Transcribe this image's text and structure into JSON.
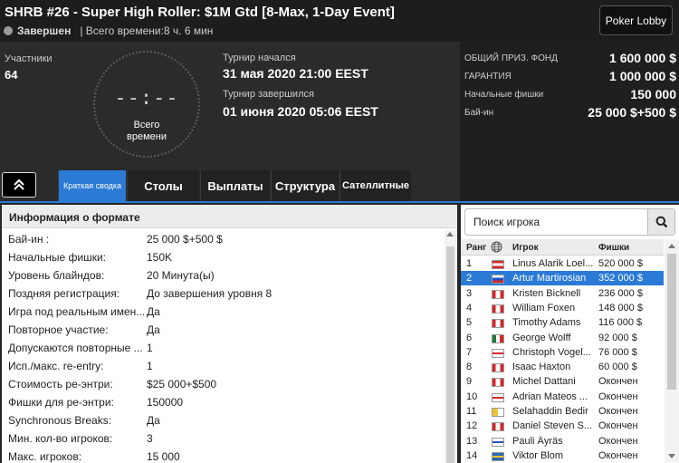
{
  "header": {
    "title": "SHRB #26 - Super High Roller: $1M Gtd [8-Max, 1-Day Event]",
    "status": "Завершен",
    "total_time": "| Всего времени:8 ч. 6 мин",
    "lobby_button": "Poker Lobby"
  },
  "info": {
    "participants_label": "Участники",
    "participants_value": "64",
    "clock_digits": "--:--",
    "clock_label_1": "Всего",
    "clock_label_2": "времени",
    "started_label": "Турнир начался",
    "started_value": "31 мая 2020  21:00 EEST",
    "ended_label": "Турнир завершился",
    "ended_value": "01 июня 2020  05:06 EEST"
  },
  "prize": [
    {
      "label": "ОБЩИЙ ПРИЗ. ФОНД",
      "value": "1 600 000 $"
    },
    {
      "label": "ГАРАНТИЯ",
      "value": "1 000 000 $"
    },
    {
      "label": "Начальные фишки",
      "value": "150 000"
    },
    {
      "label": "Бай-ин",
      "value": "25 000 $+500 $"
    }
  ],
  "tabs": [
    "Краткая сводка",
    "Столы",
    "Выплаты",
    "Структура",
    "Сателлитные"
  ],
  "format": {
    "title": "Информация о формате",
    "rows": [
      {
        "k": "Бай-ин :",
        "v": "25 000 $+500 $"
      },
      {
        "k": "Начальные фишки:",
        "v": "150K"
      },
      {
        "k": "Уровень блайндов:",
        "v": "20 Минута(ы)"
      },
      {
        "k": "Поздняя регистрация:",
        "v": "До завершения уровня 8"
      },
      {
        "k": "Игра под реальным имен...",
        "v": "Да"
      },
      {
        "k": "Повторное участие:",
        "v": "Да"
      },
      {
        "k": "Допускаются повторные ...",
        "v": "1"
      },
      {
        "k": "Исп./макс. re-entry:",
        "v": "1"
      },
      {
        "k": "Стоимость ре-энтри:",
        "v": "$25 000+$500"
      },
      {
        "k": "Фишки для ре-энтри:",
        "v": "150000"
      },
      {
        "k": "Synchronous Breaks:",
        "v": "Да"
      },
      {
        "k": "Мин. кол-во игроков:",
        "v": "3"
      },
      {
        "k": "Макс. игроков:",
        "v": "15 000"
      }
    ]
  },
  "players": {
    "search_placeholder": "Поиск игрока",
    "columns": {
      "rank": "Ранг",
      "name": "Игрок",
      "chips": "Фишки"
    },
    "rows": [
      {
        "rank": "1",
        "name": "Linus Alarik Loel...",
        "chips": "520 000 $",
        "flag": "at"
      },
      {
        "rank": "2",
        "name": "Artur Martirosian",
        "chips": "352 000 $",
        "flag": "ru"
      },
      {
        "rank": "3",
        "name": "Kristen Bicknell",
        "chips": "236 000 $",
        "flag": "ca"
      },
      {
        "rank": "4",
        "name": "William Foxen",
        "chips": "148 000 $",
        "flag": "ca"
      },
      {
        "rank": "5",
        "name": "Timothy Adams",
        "chips": "116 000 $",
        "flag": "ca"
      },
      {
        "rank": "6",
        "name": "George Wolff",
        "chips": "92 000 $",
        "flag": "mx"
      },
      {
        "rank": "7",
        "name": "Christoph Vogel...",
        "chips": "76 000 $",
        "flag": "gb"
      },
      {
        "rank": "8",
        "name": "Isaac Haxton",
        "chips": "60 000 $",
        "flag": "ca"
      },
      {
        "rank": "9",
        "name": "Michel Dattani",
        "chips": "Окончен",
        "flag": "ca"
      },
      {
        "rank": "10",
        "name": "Adrian Mateos ...",
        "chips": "Окончен",
        "flag": "gb"
      },
      {
        "rank": "11",
        "name": "Selahaddin Bedir",
        "chips": "Окончен",
        "flag": "va"
      },
      {
        "rank": "12",
        "name": "Daniel Steven S...",
        "chips": "Окончен",
        "flag": "ca"
      },
      {
        "rank": "13",
        "name": "Pauli Äyräs",
        "chips": "Окончен",
        "flag": "fi"
      },
      {
        "rank": "14",
        "name": "Viktor Blom",
        "chips": "Окончен",
        "flag": "se"
      }
    ],
    "selected_rank": "2"
  },
  "colors": {
    "accent": "#2a7ad6"
  }
}
